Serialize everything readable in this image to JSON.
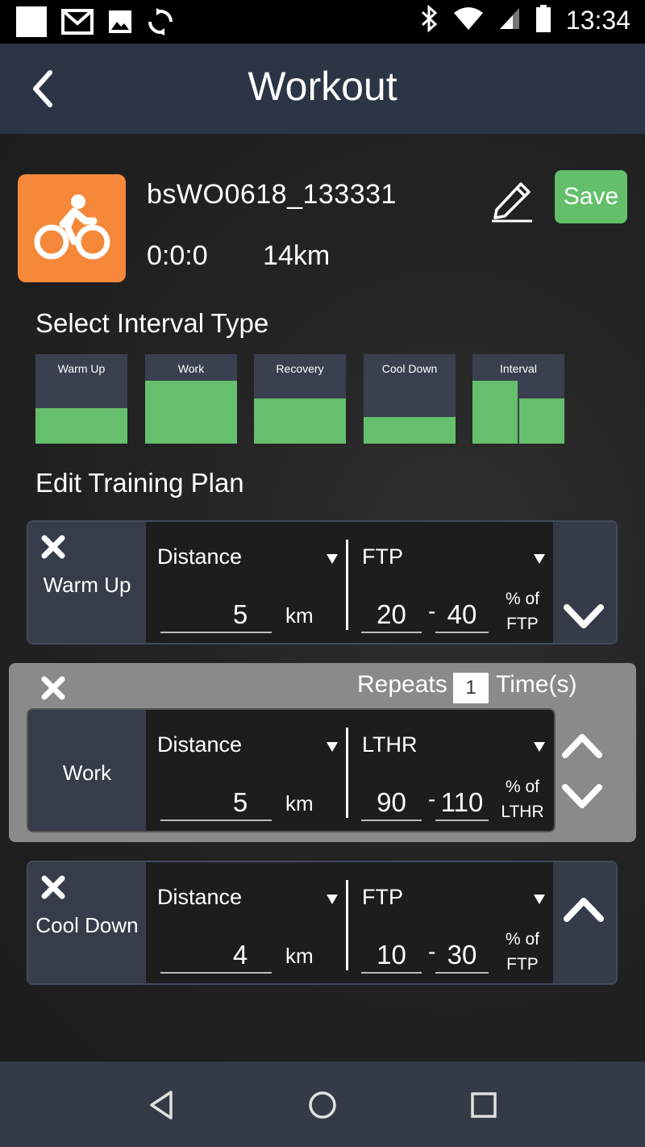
{
  "status_bar": {
    "time": "13:34",
    "icons": [
      "square-notification-icon",
      "gmail-icon",
      "image-icon",
      "sync-icon",
      "bluetooth-icon",
      "wifi-icon",
      "signal-icon",
      "battery-icon"
    ]
  },
  "header": {
    "title": "Workout",
    "back_icon": "chevron-left-icon"
  },
  "workout": {
    "sport_icon": "cycling-icon",
    "name": "bsWO0618_133331",
    "duration": "0:0:0",
    "distance": "14km",
    "save_label": "Save",
    "edit_icon": "pencil-icon"
  },
  "interval_types": {
    "title": "Select Interval Type",
    "items": [
      {
        "label": "Warm Up",
        "level": 0.4
      },
      {
        "label": "Work",
        "level": 0.7
      },
      {
        "label": "Recovery",
        "level": 0.5
      },
      {
        "label": "Cool Down",
        "level": 0.3
      },
      {
        "label": "Interval",
        "levels": [
          0.7,
          0.5
        ]
      }
    ]
  },
  "training_plan": {
    "title": "Edit Training Plan",
    "rows": [
      {
        "name": "Warm Up",
        "metric": "Distance",
        "value": "5",
        "unit": "km",
        "target": "FTP",
        "low": "20",
        "high": "40",
        "pct_line1": "% of",
        "pct_line2": "FTP"
      },
      {
        "name": "Work",
        "metric": "Distance",
        "value": "5",
        "unit": "km",
        "target": "LTHR",
        "low": "90",
        "high": "110",
        "pct_line1": "% of",
        "pct_line2": "LTHR"
      },
      {
        "name": "Cool Down",
        "metric": "Distance",
        "value": "4",
        "unit": "km",
        "target": "FTP",
        "low": "10",
        "high": "30",
        "pct_line1": "% of",
        "pct_line2": "FTP"
      }
    ],
    "repeats": {
      "label": "Repeats",
      "count": "1",
      "suffix": "Time(s)"
    },
    "dash": "-"
  },
  "nav_bar": {
    "icons": [
      "back-triangle-icon",
      "home-circle-icon",
      "recents-square-icon"
    ]
  },
  "colors": {
    "accent_green": "#63bf6a",
    "sport_orange": "#f5883a",
    "header_bg": "#2b3546"
  }
}
